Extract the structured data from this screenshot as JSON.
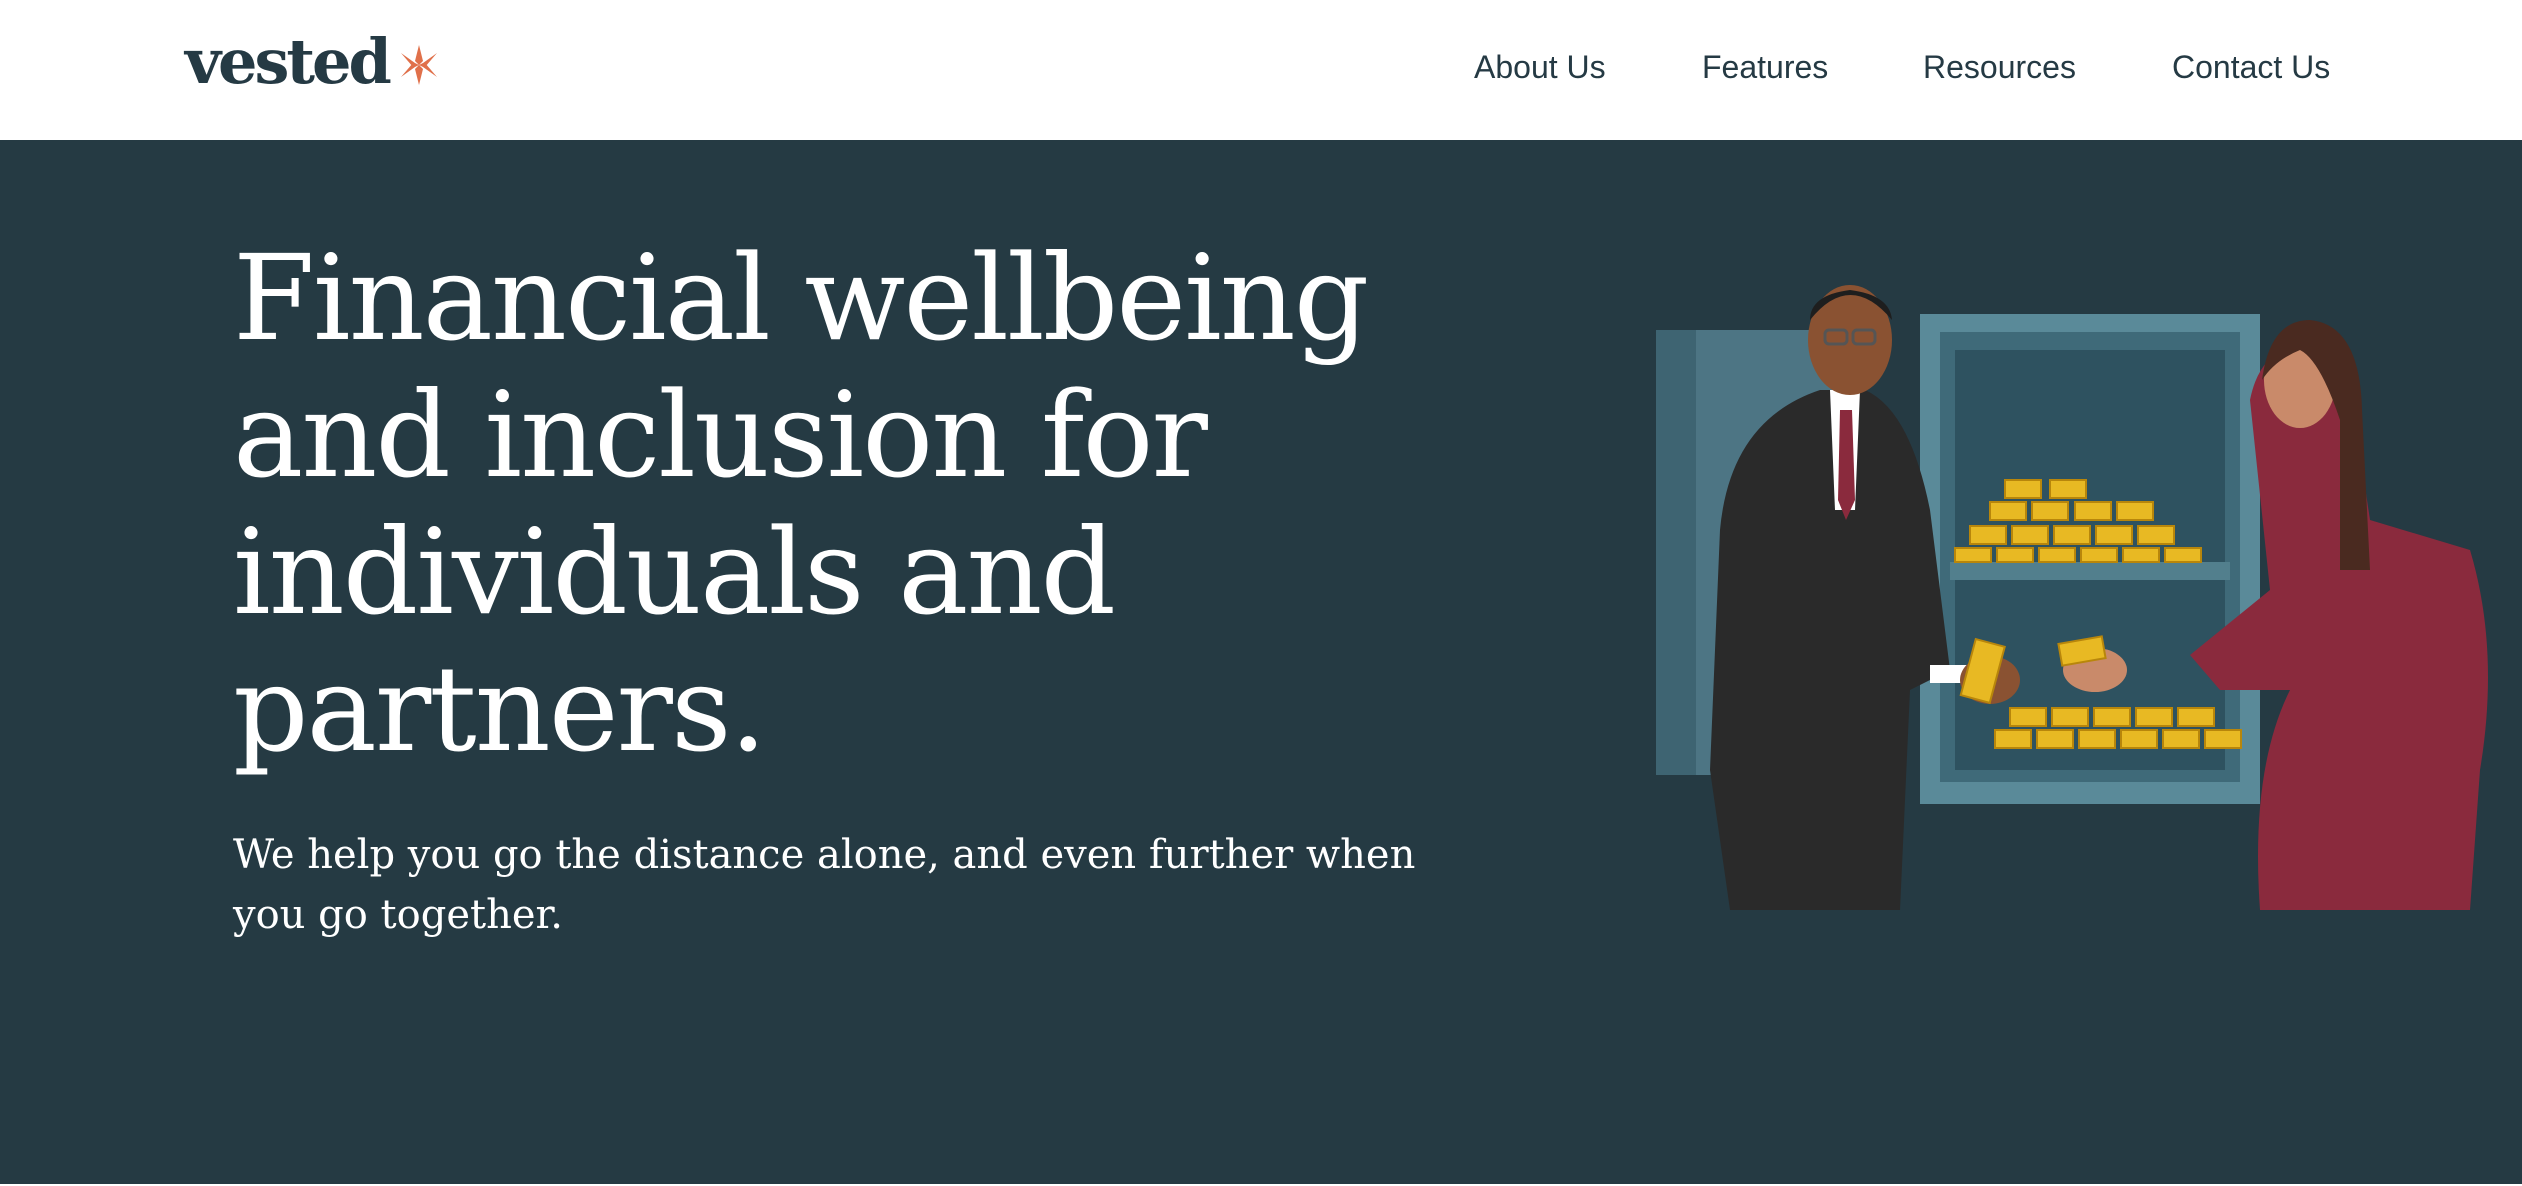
{
  "header": {
    "logo_text": "vested",
    "logo_mark_icon": "vested-star-mark",
    "nav": [
      {
        "label": "About Us"
      },
      {
        "label": "Features"
      },
      {
        "label": "Resources"
      },
      {
        "label": "Contact Us"
      }
    ]
  },
  "hero": {
    "title": "Financial wellbeing and inclusion for individuals and partners.",
    "subtitle": "We help you go the distance alone, and even further when you go together.",
    "illustration_icon": "partners-with-gold-vault-illustration"
  },
  "colors": {
    "brand_dark": "#253a43",
    "accent_orange": "#e0704a",
    "background_white": "#ffffff",
    "gold": "#e8b923",
    "tie_red": "#8a2a3d"
  }
}
